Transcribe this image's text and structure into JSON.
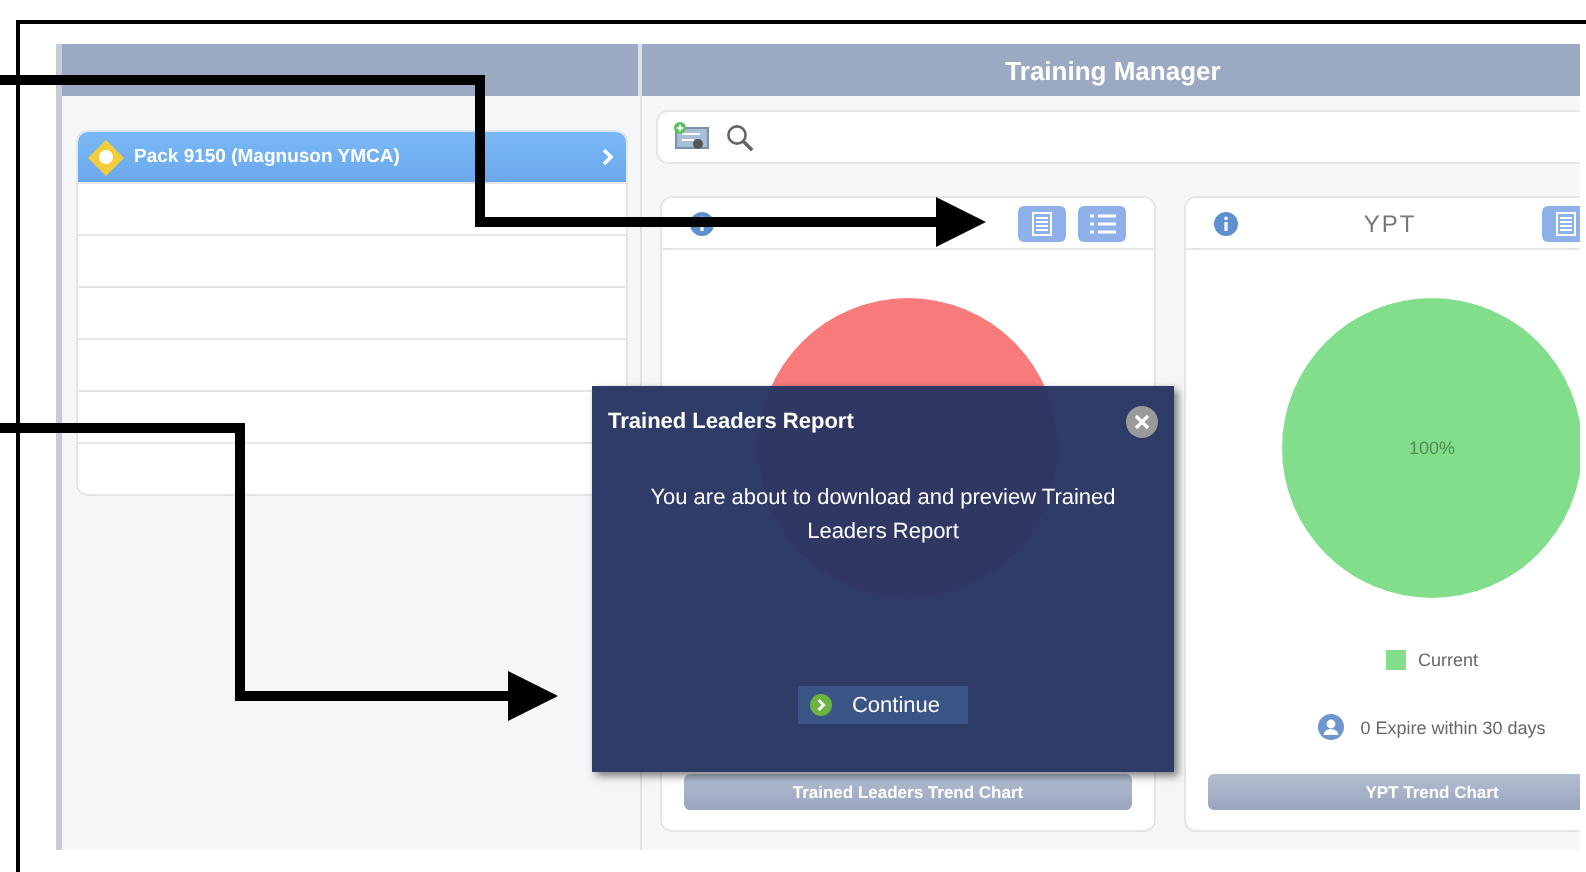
{
  "window": {
    "title": "Training Manager"
  },
  "sidebar": {
    "items": [
      {
        "label": "Pack 9150 (Magnuson YMCA)",
        "selected": true
      }
    ]
  },
  "cards": [
    {
      "color": "#f77b7b",
      "buttons": [
        {
          "kind": "report"
        },
        {
          "kind": "list"
        }
      ],
      "trend_button": "Trained Leaders Trend Chart"
    },
    {
      "title": "YPT",
      "color": "#82de8a",
      "pie_label": "100%",
      "buttons": [
        {
          "kind": "report"
        }
      ],
      "legend": [
        {
          "label": "Current",
          "color": "#82de8a"
        }
      ],
      "note": "0 Expire within 30 days",
      "trend_button": "YPT Trend Chart"
    }
  ],
  "dialog": {
    "title": "Trained Leaders Report",
    "message": "You are about to download and preview Trained Leaders Report",
    "button": "Continue"
  }
}
